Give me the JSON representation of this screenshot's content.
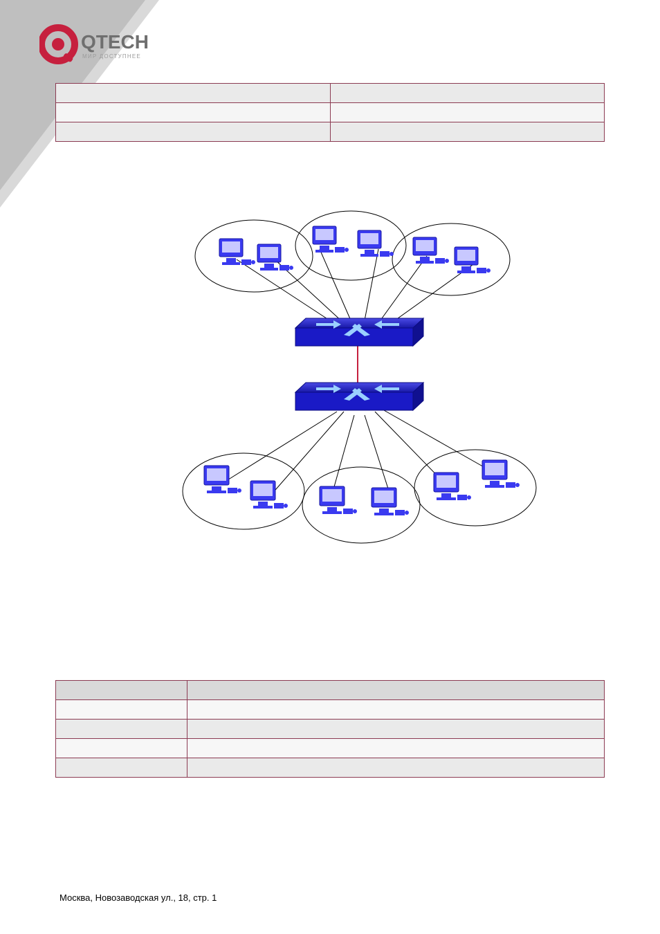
{
  "logo": {
    "brand": "QTECH",
    "tagline": "МИР ДОСТУПНЕЕ"
  },
  "table1": {
    "rows": [
      [
        "",
        ""
      ],
      [
        "",
        ""
      ],
      [
        "",
        ""
      ]
    ]
  },
  "diagram": {
    "top_groups": 3,
    "bottom_groups": 3,
    "switches": 2
  },
  "table2": {
    "rows": [
      [
        "",
        ""
      ],
      [
        "",
        ""
      ],
      [
        "",
        ""
      ],
      [
        "",
        ""
      ],
      [
        "",
        ""
      ]
    ]
  },
  "footer": "Москва, Новозаводская ул., 18, стр. 1"
}
